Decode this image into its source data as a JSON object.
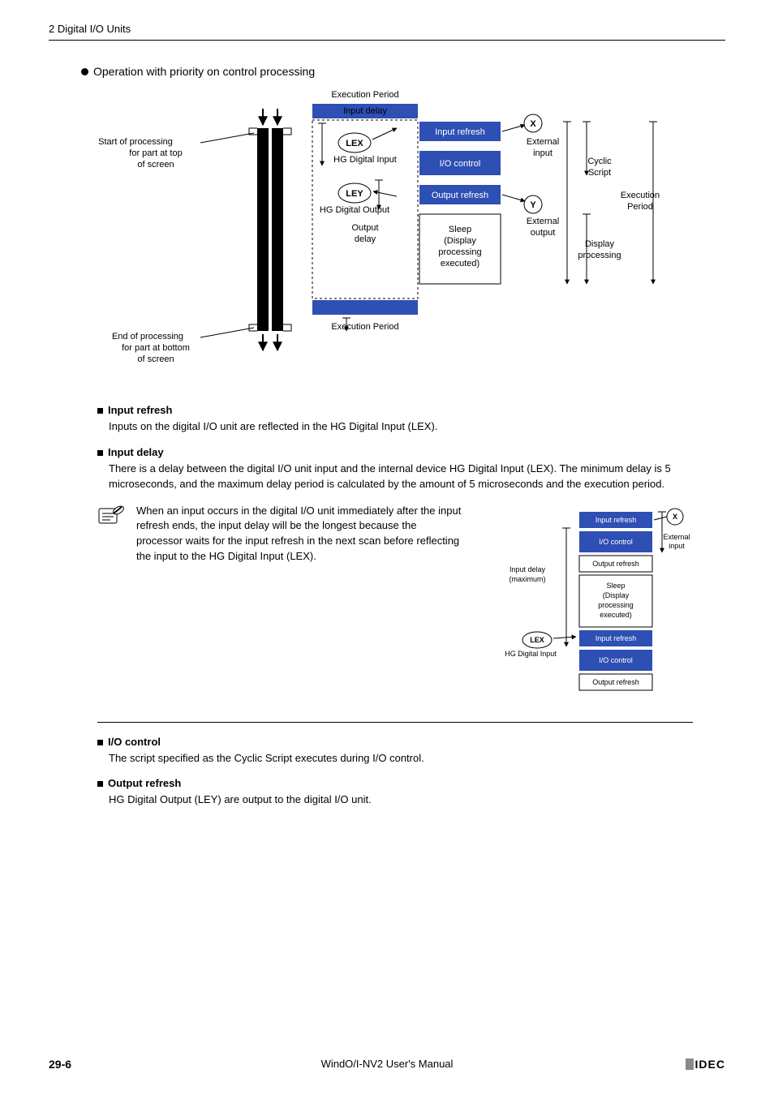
{
  "header": {
    "breadcrumb": "2 Digital I/O Units"
  },
  "section": {
    "title": "Operation with priority on control processing"
  },
  "diagram1": {
    "exec_period_top": "Execution Period",
    "input_delay": "Input delay",
    "start_l1": "Start of processing",
    "start_l2": "for part at top",
    "start_l3": "of screen",
    "lex": "LEX",
    "ley": "LEY",
    "hg_in": "HG Digital Input",
    "hg_out": "HG Digital Output",
    "output_delay1": "Output",
    "output_delay2": "delay",
    "input_refresh": "Input refresh",
    "io_control": "I/O control",
    "output_refresh": "Output refresh",
    "sleep1": "Sleep",
    "sleep2": "(Display",
    "sleep3": "processing",
    "sleep4": "executed)",
    "x": "X",
    "y": "Y",
    "ext_in1": "External",
    "ext_in2": "input",
    "ext_out1": "External",
    "ext_out2": "output",
    "cyclic1": "Cyclic",
    "cyclic2": "Script",
    "display1": "Display",
    "display2": "processing",
    "exec_period_r1": "Execution",
    "exec_period_r2": "Period",
    "exec_period_bot": "Execution Period",
    "end_l1": "End of processing",
    "end_l2": "for part at bottom",
    "end_l3": "of screen"
  },
  "items": {
    "input_refresh": {
      "title": "Input refresh",
      "body": "Inputs on the digital I/O unit are reflected in the HG Digital Input (LEX)."
    },
    "input_delay": {
      "title": "Input delay",
      "body": "There is a delay between the digital I/O unit input and the internal device HG Digital Input (LEX). The minimum delay is 5 microseconds, and the maximum delay period is calculated by the amount of 5 microseconds and the execution period."
    },
    "io_control": {
      "title": "I/O control",
      "body": "The script specified as the Cyclic Script executes during I/O control."
    },
    "output_refresh": {
      "title": "Output refresh",
      "body": "HG Digital Output (LEY) are output to the digital I/O unit."
    }
  },
  "note": {
    "text": "When an input occurs in the digital I/O unit immediately after the input refresh ends, the input delay will be the longest because the processor waits for the input refresh in the next scan before reflecting the input to the HG Digital Input (LEX)."
  },
  "diagram2": {
    "input_refresh": "Input refresh",
    "io_control": "I/O control",
    "output_refresh": "Output refresh",
    "sleep1": "Sleep",
    "sleep2": "(Display",
    "sleep3": "processing",
    "sleep4": "executed)",
    "input_delay1": "Input delay",
    "input_delay2": "(maximum)",
    "lex": "LEX",
    "hg_in": "HG Digital Input",
    "x": "X",
    "ext_in1": "External",
    "ext_in2": "input"
  },
  "footer": {
    "page": "29-6",
    "manual": "WindO/I-NV2 User's Manual",
    "logo": "IDEC"
  }
}
